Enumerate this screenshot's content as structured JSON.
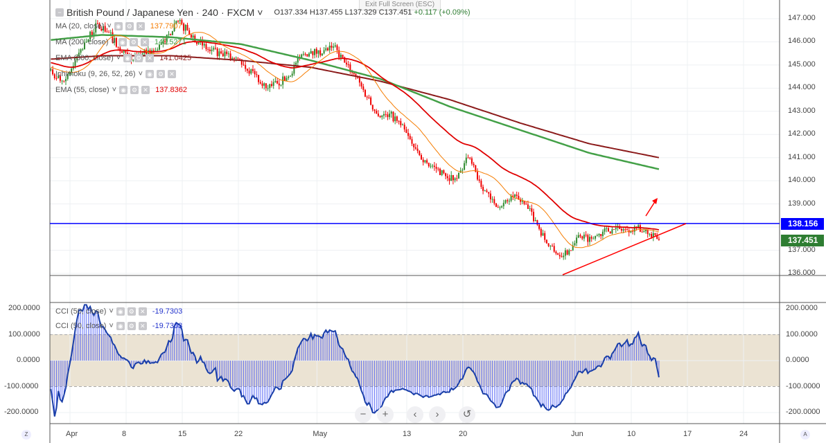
{
  "header": {
    "symbol": "British Pound / Japanese Yen",
    "interval": "240",
    "source": "FXCM",
    "open": "O137.334",
    "high": "H137.455",
    "low": "L137.329",
    "close": "C137.451",
    "change": "+0.117 (+0.09%)",
    "exit_fullscreen": "Exit Full Screen (ESC)"
  },
  "indicators": [
    {
      "label": "MA (20, close)",
      "value": "137.7907",
      "color": "#f57c00"
    },
    {
      "label": "MA (200, close)",
      "value": "140.5271",
      "color": "#43a047"
    },
    {
      "label": "EMA (300, close)",
      "value": "141.0425",
      "color": "#8b1a1a"
    },
    {
      "label": "Ichimoku (9, 26, 52, 26)",
      "value": "",
      "color": "#555"
    },
    {
      "label": "EMA (55, close)",
      "value": "137.8362",
      "color": "#e00000"
    }
  ],
  "cci_legends": [
    {
      "label": "CCI (50, close)",
      "value": "-19.7303"
    },
    {
      "label": "CCI (50, close)",
      "value": "-19.7303"
    }
  ],
  "price_axis": {
    "ticks": [
      "147.000",
      "146.000",
      "145.000",
      "144.000",
      "143.000",
      "142.000",
      "141.000",
      "140.000",
      "139.000",
      "137.000",
      "136.000"
    ],
    "values": [
      147,
      146,
      145,
      144,
      143,
      142,
      141,
      140,
      139,
      137,
      136
    ]
  },
  "cci_axis": {
    "ticks": [
      "200.0000",
      "100.0000",
      "0.0000",
      "-100.0000",
      "-200.0000"
    ],
    "values": [
      200,
      100,
      0,
      -100,
      -200
    ]
  },
  "price_tags": {
    "horizontal_line": "138.156",
    "last_price": "137.451",
    "horizontal_value": 138.156,
    "last_value": 137.451
  },
  "time_axis": [
    {
      "label": "Apr",
      "day": 0
    },
    {
      "label": "8",
      "day": 5
    },
    {
      "label": "15",
      "day": 10
    },
    {
      "label": "22",
      "day": 15
    },
    {
      "label": "May",
      "day": 22
    },
    {
      "label": "13",
      "day": 30
    },
    {
      "label": "20",
      "day": 35
    },
    {
      "label": "Jun",
      "day": 45
    },
    {
      "label": "10",
      "day": 50
    },
    {
      "label": "17",
      "day": 55
    },
    {
      "label": "24",
      "day": 60
    }
  ],
  "nav": {
    "zoom_out": "−",
    "zoom_in": "+",
    "back": "‹",
    "forward": "›",
    "reset": "↺"
  },
  "corners": {
    "left": "Z",
    "right": "A"
  },
  "chart_data": {
    "type": "candlestick",
    "daily_closes": [
      145.0,
      144.6,
      144.3,
      145.2,
      146.0,
      146.8,
      146.4,
      145.6,
      145.2,
      145.5,
      145.6,
      146.0,
      146.9,
      146.5,
      146.0,
      145.6,
      145.5,
      145.3,
      145.0,
      144.6,
      144.0,
      144.2,
      144.5,
      145.3,
      145.6,
      145.5,
      145.8,
      145.1,
      144.5,
      143.6,
      142.8,
      142.9,
      142.4,
      141.6,
      140.8,
      140.6,
      140.2,
      140.1,
      141.0,
      140.0,
      139.2,
      138.9,
      139.3,
      139.0,
      138.3,
      137.3,
      136.8,
      137.0,
      137.6,
      137.5,
      137.8,
      137.9,
      137.9,
      138.0,
      137.7,
      137.45
    ],
    "first_day_index": -3,
    "ma200": [
      146.0,
      146.3,
      146.2,
      145.9,
      145.2,
      144.4,
      143.2,
      142.2,
      141.2,
      140.5
    ],
    "ema300": [
      145.2,
      145.4,
      145.4,
      145.2,
      144.9,
      144.3,
      143.5,
      142.5,
      141.6,
      141.0
    ]
  }
}
